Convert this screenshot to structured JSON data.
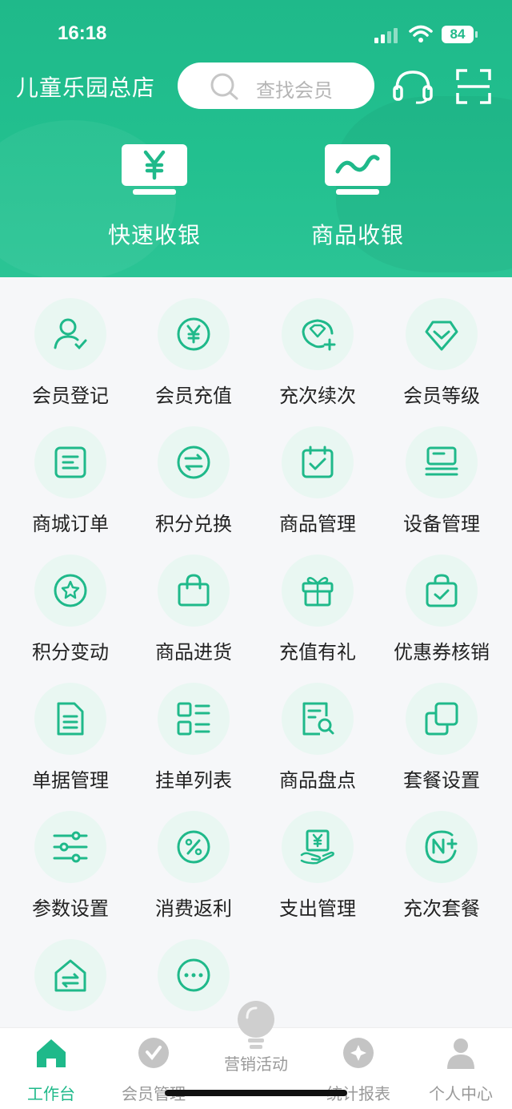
{
  "status": {
    "time": "16:18",
    "battery": "84"
  },
  "header": {
    "store_name": "儿童乐园总店",
    "search_placeholder": "查找会员",
    "quick_actions": [
      {
        "label": "快速收银",
        "icon": "yen-monitor-icon"
      },
      {
        "label": "商品收银",
        "icon": "trend-monitor-icon"
      }
    ]
  },
  "grid": [
    {
      "label": "会员登记",
      "icon": "user-check-icon"
    },
    {
      "label": "会员充值",
      "icon": "yen-circle-icon"
    },
    {
      "label": "充次续次",
      "icon": "diamond-plus-icon"
    },
    {
      "label": "会员等级",
      "icon": "gem-icon"
    },
    {
      "label": "商城订单",
      "icon": "order-doc-icon"
    },
    {
      "label": "积分兑换",
      "icon": "exchange-icon"
    },
    {
      "label": "商品管理",
      "icon": "calendar-check-icon"
    },
    {
      "label": "设备管理",
      "icon": "device-icon"
    },
    {
      "label": "积分变动",
      "icon": "star-circle-icon"
    },
    {
      "label": "商品进货",
      "icon": "shopping-bag-icon"
    },
    {
      "label": "充值有礼",
      "icon": "gift-icon"
    },
    {
      "label": "优惠券核销",
      "icon": "coupon-check-icon"
    },
    {
      "label": "单据管理",
      "icon": "document-icon"
    },
    {
      "label": "挂单列表",
      "icon": "list-grid-icon"
    },
    {
      "label": "商品盘点",
      "icon": "inventory-search-icon"
    },
    {
      "label": "套餐设置",
      "icon": "copy-icon"
    },
    {
      "label": "参数设置",
      "icon": "sliders-icon"
    },
    {
      "label": "消费返利",
      "icon": "percent-icon"
    },
    {
      "label": "支出管理",
      "icon": "yen-hand-icon"
    },
    {
      "label": "充次套餐",
      "icon": "n-plus-icon"
    },
    {
      "label": "",
      "icon": "store-return-icon"
    },
    {
      "label": "",
      "icon": "more-icon"
    }
  ],
  "tabbar": [
    {
      "label": "工作台",
      "icon": "home-icon",
      "active": true
    },
    {
      "label": "会员管理",
      "icon": "check-badge-icon",
      "active": false
    },
    {
      "label": "营销活动",
      "icon": "bulb-icon",
      "active": false
    },
    {
      "label": "统计报表",
      "icon": "chart-badge-icon",
      "active": false
    },
    {
      "label": "个人中心",
      "icon": "person-icon",
      "active": false
    }
  ],
  "colors": {
    "brand": "#1fb98a",
    "icon_bg": "#e9f7f2",
    "text": "#222222",
    "inactive": "#999999"
  }
}
